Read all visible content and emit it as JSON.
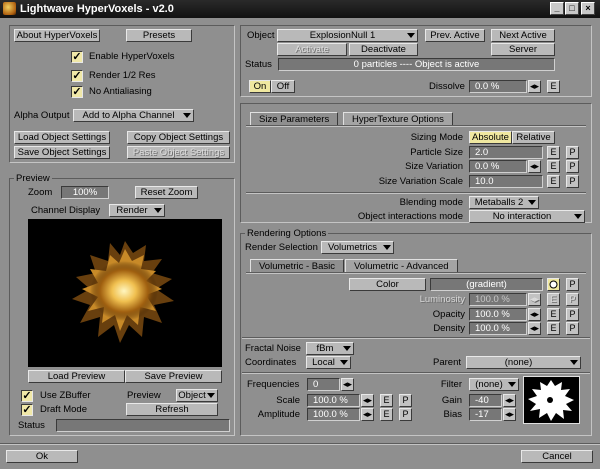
{
  "window": {
    "title": "Lightwave HyperVoxels - v2.0",
    "minimize": "_",
    "maximize": "□",
    "close": "×"
  },
  "left": {
    "about_button": "About HyperVoxels",
    "presets_button": "Presets",
    "enable_label": "Enable HyperVoxels",
    "render_half_label": "Render 1/2 Res",
    "no_aa_label": "No Antialiasing",
    "check_mark": "✓",
    "alpha_output_label": "Alpha Output",
    "alpha_output_value": "Add to Alpha Channel",
    "load_settings": "Load Object Settings",
    "copy_settings": "Copy Object Settings",
    "save_settings": "Save Object Settings",
    "paste_settings": "Paste Object Settings"
  },
  "preview": {
    "group_label": "Preview",
    "zoom_label": "Zoom",
    "zoom_value": "100%",
    "reset_zoom": "Reset Zoom",
    "channel_label": "Channel Display",
    "channel_value": "Render",
    "load_preview": "Load Preview",
    "save_preview": "Save Preview",
    "use_zbuffer": "Use ZBuffer",
    "draft_mode": "Draft Mode",
    "preview_label": "Preview",
    "preview_value": "Object",
    "refresh": "Refresh",
    "status_label": "Status",
    "status_value": ""
  },
  "object": {
    "label": "Object",
    "value": "ExplosionNull 1",
    "prev_active": "Prev. Active",
    "next_active": "Next Active",
    "activate": "Activate",
    "deactivate": "Deactivate",
    "server": "Server",
    "status_label": "Status",
    "status_value": "0 particles ---- Object is active",
    "on": "On",
    "off": "Off",
    "dissolve_label": "Dissolve",
    "dissolve_value": "0.0 %"
  },
  "size_tabs": [
    "Size Parameters",
    "HyperTexture Options"
  ],
  "size": {
    "sizing_mode_label": "Sizing Mode",
    "absolute": "Absolute",
    "relative": "Relative",
    "particle_size_label": "Particle Size",
    "particle_size_value": "2.0",
    "size_variation_label": "Size Variation",
    "size_variation_value": "0.0 %",
    "size_var_scale_label": "Size Variation Scale",
    "size_var_scale_value": "10.0",
    "blending_label": "Blending mode",
    "blending_value": "Metaballs 2",
    "interactions_label": "Object interactions mode",
    "interactions_value": "No interaction"
  },
  "rendering": {
    "group_label": "Rendering Options",
    "render_selection_label": "Render Selection",
    "render_selection_value": "Volumetrics",
    "tabs": [
      "Volumetric - Basic",
      "Volumetric - Advanced"
    ],
    "color_button": "Color",
    "color_value": "(gradient)",
    "luminosity_label": "Luminosity",
    "luminosity_value": "100.0 %",
    "opacity_label": "Opacity",
    "opacity_value": "100.0 %",
    "density_label": "Density",
    "density_value": "100.0 %",
    "fractal_label": "Fractal Noise",
    "fractal_value": "fBm",
    "coords_label": "Coordinates",
    "coords_value": "Local",
    "parent_label": "Parent",
    "parent_value": "(none)",
    "freq_label": "Frequencies",
    "freq_value": "0",
    "scale_label": "Scale",
    "scale_value": "100.0 %",
    "amplitude_label": "Amplitude",
    "amplitude_value": "100.0 %",
    "filter_label": "Filter",
    "filter_value": "(none)",
    "gain_label": "Gain",
    "gain_value": "-40",
    "bias_label": "Bias",
    "bias_value": "-17"
  },
  "small": {
    "e": "E",
    "p": "P",
    "arrows": "◂▸"
  },
  "footer": {
    "ok": "Ok",
    "cancel": "Cancel"
  },
  "colors": {
    "accent": "#f0e8a0",
    "panel": "#8f8f8f",
    "field": "#777777"
  }
}
